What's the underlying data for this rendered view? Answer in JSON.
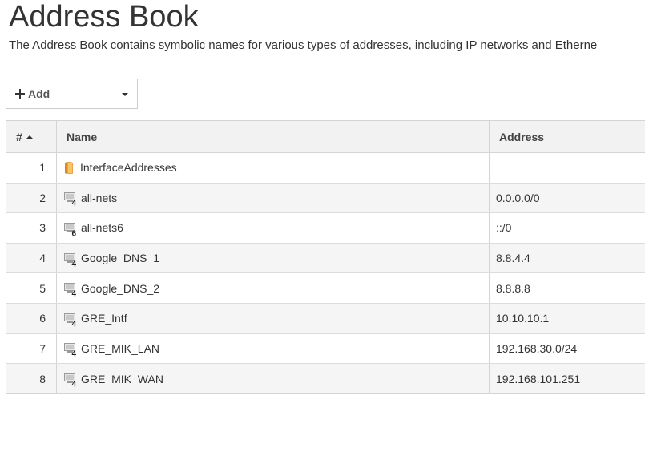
{
  "page": {
    "title": "Address Book",
    "description": "The Address Book contains symbolic names for various types of addresses, including IP networks and Etherne"
  },
  "toolbar": {
    "add_label": "Add",
    "add_icon": "plus-icon",
    "dropdown_icon": "caret-down-icon"
  },
  "table": {
    "columns": {
      "num": "#",
      "name": "Name",
      "address": "Address"
    },
    "sort": {
      "column": "#",
      "direction": "ascending"
    },
    "rows": [
      {
        "num": "1",
        "name": "InterfaceAddresses",
        "address": "",
        "icon": "folder-icon"
      },
      {
        "num": "2",
        "name": "all-nets",
        "address": "0.0.0.0/0",
        "icon": "ipv4-address-icon",
        "badge": "4"
      },
      {
        "num": "3",
        "name": "all-nets6",
        "address": "::/0",
        "icon": "ipv6-address-icon",
        "badge": "6"
      },
      {
        "num": "4",
        "name": "Google_DNS_1",
        "address": "8.8.4.4",
        "icon": "ipv4-address-icon",
        "badge": "4"
      },
      {
        "num": "5",
        "name": "Google_DNS_2",
        "address": "8.8.8.8",
        "icon": "ipv4-address-icon",
        "badge": "4"
      },
      {
        "num": "6",
        "name": "GRE_Intf",
        "address": "10.10.10.1",
        "icon": "ipv4-address-icon",
        "badge": "4"
      },
      {
        "num": "7",
        "name": "GRE_MIK_LAN",
        "address": "192.168.30.0/24",
        "icon": "ipv4-address-icon",
        "badge": "4"
      },
      {
        "num": "8",
        "name": "GRE_MIK_WAN",
        "address": "192.168.101.251",
        "icon": "ipv4-address-icon",
        "badge": "4"
      }
    ]
  },
  "colors": {
    "header_bg": "#f2f2f2",
    "alt_row_bg": "#f5f5f5",
    "border": "#d4d4d4",
    "folder": "#f0a640"
  }
}
